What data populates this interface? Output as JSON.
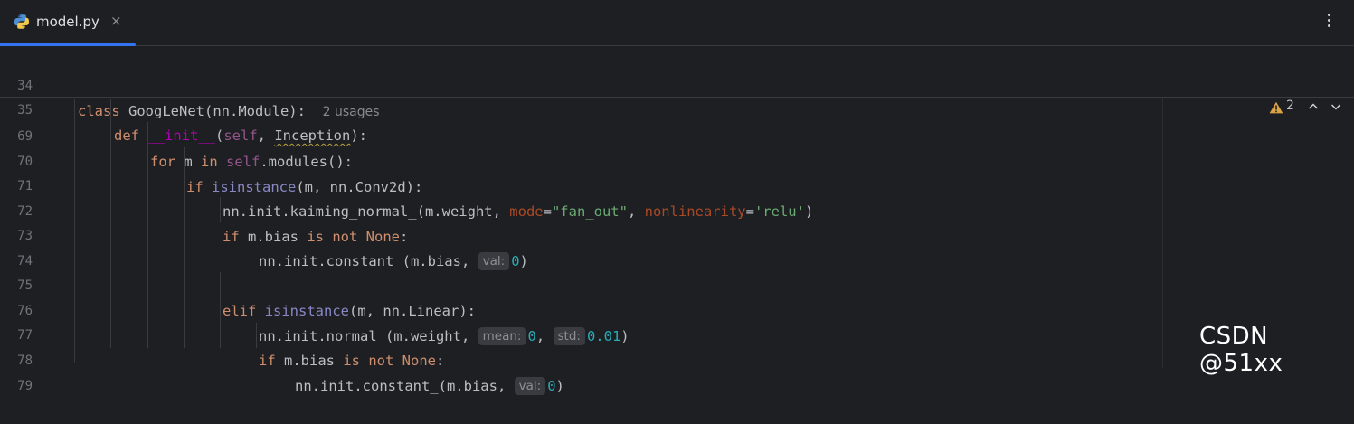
{
  "tab": {
    "filename": "model.py",
    "close_glyph": "×",
    "icon": "python-icon"
  },
  "toolbar": {
    "menu_icon": "kebab-menu-icon"
  },
  "inspections": {
    "warning_count": "2",
    "icon": "warning-icon"
  },
  "sticky": {
    "line34": {
      "number": "34",
      "kw": "class",
      "text": " GoogLeNet(nn.Module):",
      "usages": "2 usages"
    },
    "line35": {
      "number": "35",
      "kw": "def",
      "dunder": "__init__",
      "open": "(",
      "self": "self",
      "mid": ", ",
      "param": "Inception",
      "close": "):"
    }
  },
  "lines": {
    "l69": {
      "number": "69",
      "kw": "for",
      "a": " m ",
      "kw2": "in",
      "b": " ",
      "self": "self",
      "c": ".modules():"
    },
    "l70": {
      "number": "70",
      "kw": "if",
      "b": " ",
      "builtin": "isinstance",
      "c": "(m, nn.Conv2d):"
    },
    "l71": {
      "number": "71",
      "a": "nn.init.kaiming_normal_(m.weight, ",
      "p1": "mode",
      "eq1": "=",
      "s1": "\"fan_out\"",
      "comma": ", ",
      "p2": "nonlinearity",
      "eq2": "=",
      "s2": "'relu'",
      "close": ")"
    },
    "l72": {
      "number": "72",
      "kw": "if",
      "a": " m.bias ",
      "kw2": "is not None",
      "b": ":"
    },
    "l73": {
      "number": "73",
      "a": "nn.init.constant_(m.bias, ",
      "hint": "val:",
      "num": "0",
      "close": ")"
    },
    "l74": {
      "number": "74"
    },
    "l75": {
      "number": "75",
      "kw": "elif",
      "b": " ",
      "builtin": "isinstance",
      "c": "(m, nn.Linear):"
    },
    "l76": {
      "number": "76",
      "a": "nn.init.normal_(m.weight, ",
      "hint1": "mean:",
      "num1": "0",
      "comma": ", ",
      "hint2": "std:",
      "num2": "0.01",
      "close": ")"
    },
    "l77": {
      "number": "77",
      "kw": "if",
      "a": " m.bias ",
      "kw2": "is not None",
      "b": ":"
    },
    "l78": {
      "number": "78",
      "a": "nn.init.constant_(m.bias, ",
      "hint": "val:",
      "num": "0",
      "close": ")"
    },
    "l79": {
      "number": "79"
    }
  },
  "watermark": "CSDN @51xx",
  "colors": {
    "accent": "#3574f0",
    "keyword": "#cf8e6d",
    "string": "#6aab73",
    "number": "#2aacb8",
    "self": "#94558d",
    "param": "#aa4926"
  }
}
